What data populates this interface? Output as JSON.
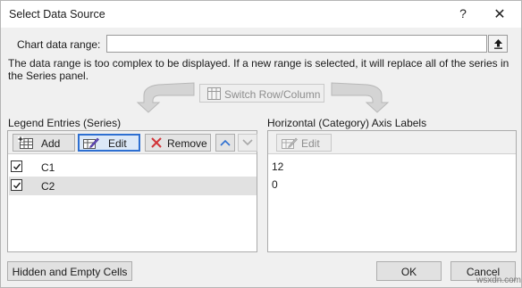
{
  "dialog": {
    "title": "Select Data Source",
    "help_glyph": "?",
    "close_glyph": "✕"
  },
  "range": {
    "label": "Chart data range:",
    "value": "",
    "message": "The data range is too complex to be displayed. If a new range is selected, it will replace all of the series in the Series panel."
  },
  "switch": {
    "label": "Switch Row/Column"
  },
  "legend": {
    "title": "Legend Entries (Series)",
    "add_label": "Add",
    "edit_label": "Edit",
    "remove_label": "Remove",
    "series": [
      {
        "name": "C1",
        "checked": true,
        "selected": false
      },
      {
        "name": "C2",
        "checked": true,
        "selected": true
      }
    ]
  },
  "axis": {
    "title": "Horizontal (Category) Axis Labels",
    "edit_label": "Edit",
    "items": [
      "12",
      "0"
    ]
  },
  "footer": {
    "hidden_empty_label": "Hidden and Empty Cells",
    "ok_label": "OK",
    "cancel_label": "Cancel",
    "watermark": "wsxdn.com"
  },
  "colors": {
    "focus_border": "#2d6fd1",
    "remove_x": "#d13438",
    "arrow_gray": "#c8c8c8",
    "disabled_text": "#8d8d8d"
  }
}
